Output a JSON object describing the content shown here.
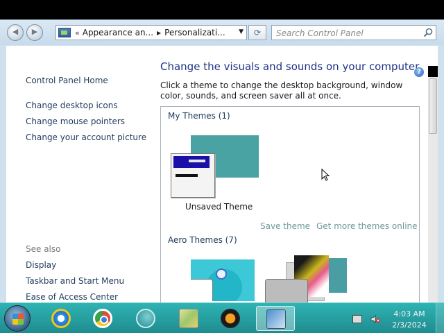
{
  "window": {
    "breadcrumb": [
      "Appearance an...",
      "Personalizati..."
    ],
    "breadcrumb_prefix": "«",
    "search_placeholder": "Search Control Panel"
  },
  "sidebar": {
    "home": "Control Panel Home",
    "tasks": [
      "Change desktop icons",
      "Change mouse pointers",
      "Change your account picture"
    ],
    "see_also_label": "See also",
    "see_also": [
      "Display",
      "Taskbar and Start Menu",
      "Ease of Access Center"
    ]
  },
  "main": {
    "title": "Change the visuals and sounds on your computer",
    "description": "Click a theme to change the desktop background, window color, sounds, and screen saver all at once.",
    "my_themes_label": "My Themes (1)",
    "unsaved_theme_name": "Unsaved Theme",
    "save_theme_link": "Save theme",
    "get_more_link": "Get more themes online",
    "aero_themes_label": "Aero Themes (7)"
  },
  "taskbar": {
    "apps": [
      "internet-explorer",
      "chrome",
      "edge",
      "maps",
      "media-player",
      "control-panel"
    ],
    "active_app": "control-panel",
    "time": "4:03 AM",
    "date": "2/3/2024"
  },
  "colors": {
    "link": "#1e395b",
    "title": "#1e3287",
    "taskbar": "#1f8c8f",
    "theme_bg": "#4aa3a3"
  }
}
